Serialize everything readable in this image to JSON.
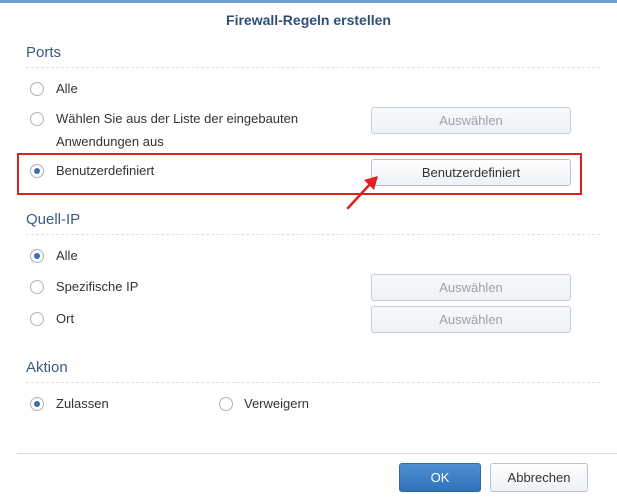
{
  "dialog": {
    "title": "Firewall-Regeln erstellen"
  },
  "ports": {
    "heading": "Ports",
    "options": [
      {
        "label": "Alle",
        "checked": false
      },
      {
        "label_line1": "Wählen Sie aus der Liste der eingebauten",
        "label_line2": "Anwendungen aus",
        "checked": false,
        "button": "Auswählen"
      },
      {
        "label": "Benutzerdefiniert",
        "checked": true,
        "button": "Benutzerdefiniert"
      }
    ]
  },
  "source_ip": {
    "heading": "Quell-IP",
    "options": [
      {
        "label": "Alle",
        "checked": true
      },
      {
        "label": "Spezifische IP",
        "checked": false,
        "button": "Auswählen"
      },
      {
        "label": "Ort",
        "checked": false,
        "button": "Auswählen"
      }
    ]
  },
  "action": {
    "heading": "Aktion",
    "options": [
      {
        "label": "Zulassen",
        "checked": true
      },
      {
        "label": "Verweigern",
        "checked": false
      }
    ]
  },
  "footer": {
    "ok": "OK",
    "cancel": "Abbrechen"
  },
  "colors": {
    "accent": "#3a6fb0",
    "highlight": "#e02020",
    "heading": "#3c5a82"
  }
}
